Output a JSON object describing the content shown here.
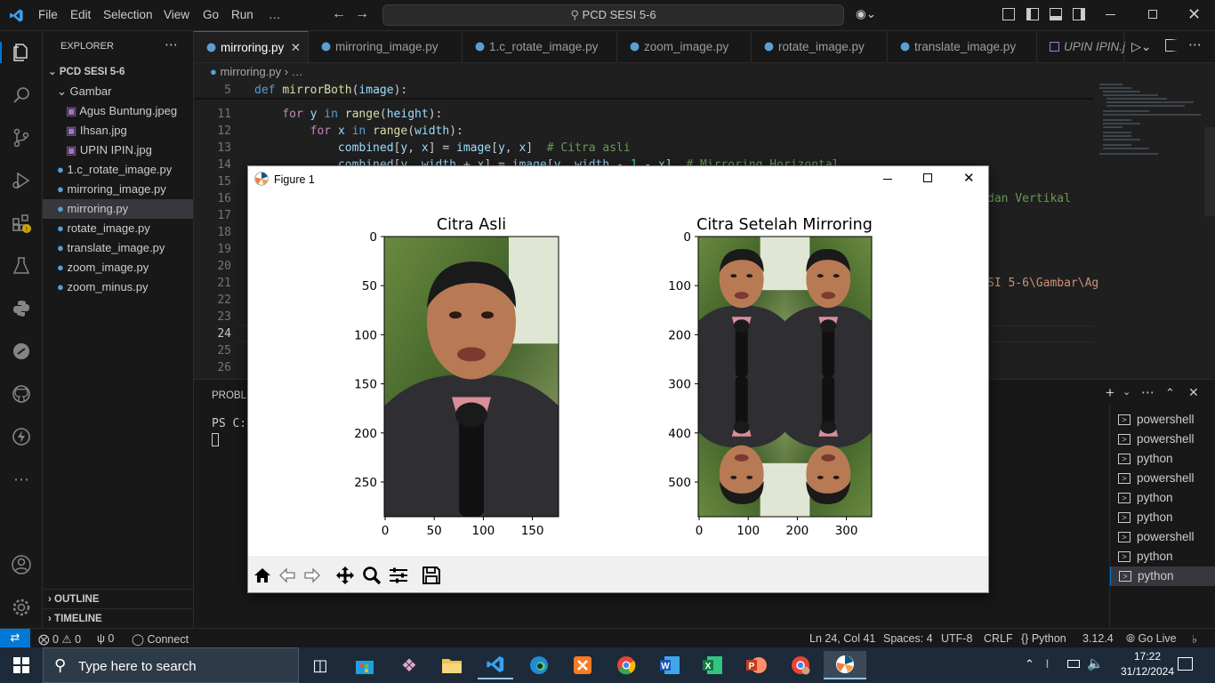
{
  "titlebar": {
    "menus": [
      "File",
      "Edit",
      "Selection",
      "View",
      "Go",
      "Run",
      "…"
    ],
    "search_text": "PCD SESI 5-6"
  },
  "sidebar": {
    "header": "EXPLORER",
    "folder": "PCD SESI 5-6",
    "subfolder": "Gambar",
    "images": [
      "Agus Buntung.jpeg",
      "Ihsan.jpg",
      "UPIN IPIN.jpg"
    ],
    "files": [
      "1.c_rotate_image.py",
      "mirroring_image.py",
      "mirroring.py",
      "rotate_image.py",
      "translate_image.py",
      "zoom_image.py",
      "zoom_minus.py"
    ],
    "outline": "OUTLINE",
    "timeline": "TIMELINE"
  },
  "tabs": [
    "mirroring.py",
    "mirroring_image.py",
    "1.c_rotate_image.py",
    "zoom_image.py",
    "rotate_image.py",
    "translate_image.py",
    "UPIN IPIN.j"
  ],
  "breadcrumb": {
    "file": "mirroring.py",
    "rest": "…"
  },
  "editor": {
    "sticky_line": {
      "num": "5",
      "kw": "def",
      "fn": "mirrorBoth",
      "arg": "image"
    },
    "lines": [
      {
        "num": "11"
      },
      {
        "num": "12"
      },
      {
        "num": "13"
      },
      {
        "num": "14"
      },
      {
        "num": "15"
      },
      {
        "num": "16"
      },
      {
        "num": "17"
      },
      {
        "num": "18"
      },
      {
        "num": "19"
      },
      {
        "num": "20"
      },
      {
        "num": "21"
      },
      {
        "num": "22"
      },
      {
        "num": "23"
      },
      {
        "num": "24"
      },
      {
        "num": "25"
      },
      {
        "num": "26"
      }
    ],
    "visible_fragment_16": "dan Vertikal",
    "visible_fragment_21a": "SI 5-6",
    "visible_fragment_21b": "\\Gambar\\Ag"
  },
  "panel": {
    "tab_label": "PROBLE",
    "prompt": "PS C:\\",
    "terminals": [
      "powershell",
      "powershell",
      "python",
      "powershell",
      "python",
      "python",
      "powershell",
      "python",
      "python"
    ]
  },
  "figure": {
    "window_title": "Figure 1",
    "left_plot": {
      "title": "Citra Asli",
      "yticks": [
        "0",
        "50",
        "100",
        "150",
        "200",
        "250"
      ],
      "xticks": [
        "0",
        "50",
        "100",
        "150"
      ]
    },
    "right_plot": {
      "title": "Citra Setelah Mirroring",
      "yticks": [
        "0",
        "100",
        "200",
        "300",
        "400",
        "500"
      ],
      "xticks": [
        "0",
        "100",
        "200",
        "300"
      ]
    }
  },
  "statusbar": {
    "errors": "0",
    "warnings": "0",
    "ports": "0",
    "connect": "Connect",
    "position": "Ln 24, Col 41",
    "spaces": "Spaces: 4",
    "encoding": "UTF-8",
    "eol": "CRLF",
    "language": "Python",
    "version": "3.12.4",
    "golive": "Go Live"
  },
  "taskbar": {
    "search_placeholder": "Type here to search",
    "time": "17:22",
    "date": "31/12/2024"
  },
  "colors": {
    "accent": "#0078d4",
    "editor_bg": "#1f1f1f",
    "sidebar_bg": "#181818"
  }
}
